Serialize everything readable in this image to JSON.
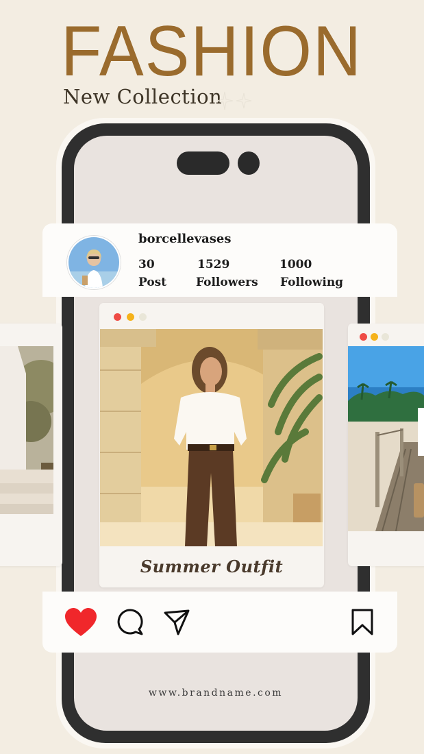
{
  "header": {
    "title": "FASHION",
    "subtitle": "New Collection"
  },
  "profile": {
    "username": "borcellevases",
    "stats": [
      {
        "value": "30",
        "label": "Post"
      },
      {
        "value": "1529",
        "label": "Followers"
      },
      {
        "value": "1000",
        "label": "Following"
      }
    ]
  },
  "post": {
    "caption": "Summer Outfit",
    "window_dot_colors": [
      "#ef4b45",
      "#f5b21b",
      "#e9e6d8"
    ]
  },
  "actions": {
    "icons": [
      "heart-icon",
      "comment-icon",
      "share-icon",
      "bookmark-icon"
    ],
    "like_color": "#f0272b"
  },
  "footer": {
    "url": "www.brandname.com"
  },
  "colors": {
    "background": "#f3ede2",
    "title": "#9a6b2d",
    "phone_frame": "#2f2f2f"
  }
}
